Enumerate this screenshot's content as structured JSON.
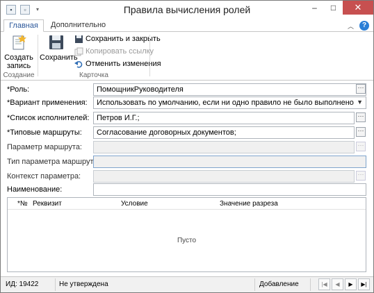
{
  "window": {
    "title": "Правила вычисления ролей"
  },
  "ribbon": {
    "tabs": [
      {
        "label": "Главная"
      },
      {
        "label": "Дополнительно"
      }
    ],
    "groups": {
      "create": {
        "label": "Создание",
        "button": "Создать\nзапись"
      },
      "card": {
        "label": "Карточка",
        "save": "Сохранить",
        "save_close": "Сохранить и закрыть",
        "copy_link": "Копировать ссылку",
        "undo": "Отменить изменения"
      }
    }
  },
  "form": {
    "role": {
      "label": "*Роль:",
      "value": "ПомощникРуководителя"
    },
    "apply_variant": {
      "label": "*Вариант применения:",
      "value": "Использовать по умолчанию, если ни одно правило не было выполнено"
    },
    "executors": {
      "label": "*Список исполнителей:",
      "value": "Петров И.Г.;"
    },
    "routes": {
      "label": "*Типовые маршруты:",
      "value": "Согласование договорных документов;"
    },
    "route_param": {
      "label": "Параметр маршрута:",
      "value": ""
    },
    "route_param_type": {
      "label": "Тип параметра маршрута:",
      "value": ""
    },
    "param_context": {
      "label": "Контекст параметра:",
      "value": ""
    },
    "name": {
      "label": "Наименование:",
      "value": ""
    }
  },
  "grid": {
    "columns": [
      "*№",
      "Реквизит",
      "Условие",
      "Значение разреза"
    ],
    "empty_text": "Пусто"
  },
  "status": {
    "id": "ИД: 19422",
    "state": "Не утверждена",
    "mode": "Добавление"
  },
  "icons": {
    "qat": [
      "save-icon",
      "back-icon"
    ],
    "nav": [
      "first-icon",
      "prev-icon",
      "next-icon",
      "last-icon"
    ]
  }
}
